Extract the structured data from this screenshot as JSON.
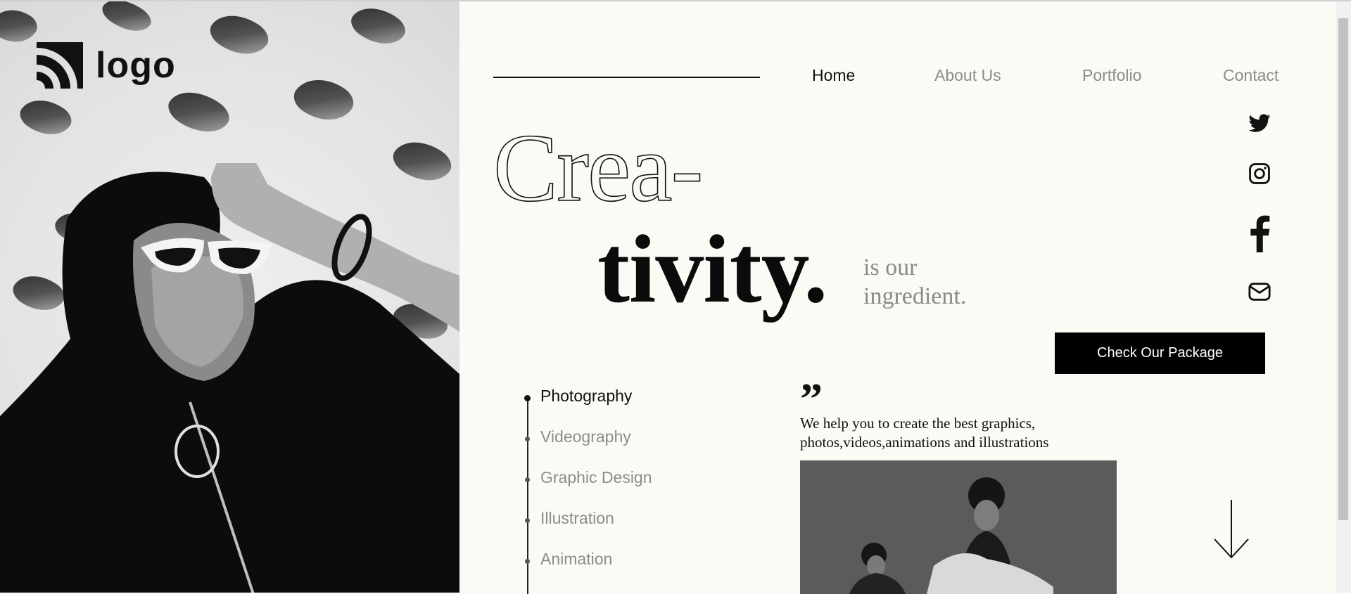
{
  "brand": {
    "logo_text": "logo"
  },
  "nav": {
    "items": [
      {
        "label": "Home",
        "active": true
      },
      {
        "label": "About Us",
        "active": false
      },
      {
        "label": "Portfolio",
        "active": false
      },
      {
        "label": "Contact",
        "active": false
      }
    ]
  },
  "hero": {
    "line1": "Crea-",
    "line2": "tivity.",
    "tagline_1": "is our",
    "tagline_2": "ingredient."
  },
  "social": [
    "twitter-icon",
    "instagram-icon",
    "facebook-icon",
    "mail-icon"
  ],
  "cta": {
    "label": "Check Our Package"
  },
  "services": {
    "items": [
      {
        "label": "Photography",
        "active": true
      },
      {
        "label": "Videography",
        "active": false
      },
      {
        "label": "Graphic Design",
        "active": false
      },
      {
        "label": "Illustration",
        "active": false
      },
      {
        "label": "Animation",
        "active": false
      }
    ]
  },
  "quote": {
    "mark": "”",
    "line1": "We help you to create the best graphics,",
    "line2": "photos,videos,animations and illustrations"
  },
  "colors": {
    "accent": "#000000",
    "background": "#fcfaf5",
    "muted_text": "#8c8c8c"
  }
}
